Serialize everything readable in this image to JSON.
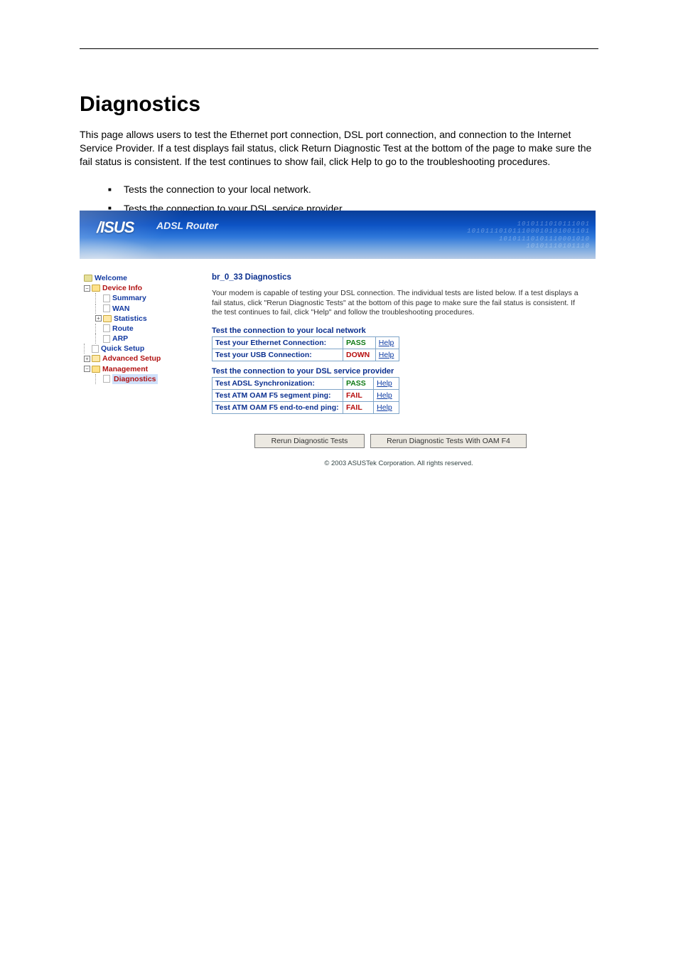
{
  "doc": {
    "section_title": "Diagnostics",
    "intro": "This page allows users to test the Ethernet port connection, DSL port connection, and connection to the Internet Service Provider. If a test displays fail status, click Return Diagnostic Test at the bottom of the page to make sure the fail status is consistent. If the test continues to show fail, click Help to go to the troubleshooting procedures.",
    "bullets": [
      "Tests the connection to your local network.",
      "Tests the connection to your DSL service provider."
    ]
  },
  "banner": {
    "brand": "/ISUS",
    "sub": "ADSL Router",
    "bin1": "1010111010111001",
    "bin2": "101011101011100010101001101",
    "bin3": "10101110101110001010",
    "bin4": "10101110101110"
  },
  "nav": {
    "welcome": "Welcome",
    "device_info": "Device Info",
    "summary": "Summary",
    "wan": "WAN",
    "statistics": "Statistics",
    "route": "Route",
    "arp": "ARP",
    "quick_setup": "Quick Setup",
    "advanced_setup": "Advanced Setup",
    "management": "Management",
    "diagnostics": "Diagnostics"
  },
  "content": {
    "title": "br_0_33 Diagnostics",
    "para": "Your modem is capable of testing your DSL connection. The individual tests are listed below. If a test displays a fail status, click \"Rerun Diagnostic Tests\" at the bottom of this page to make sure the fail status is consistent. If the test continues to fail, click \"Help\" and follow the troubleshooting procedures.",
    "h1": "Test the connection to your local network",
    "h2": "Test the connection to your DSL service provider",
    "local": [
      {
        "name": "Test your Ethernet Connection:",
        "status": "PASS",
        "cls": "pass",
        "help": "Help"
      },
      {
        "name": "Test your USB Connection:",
        "status": "DOWN",
        "cls": "down",
        "help": "Help"
      }
    ],
    "dsl": [
      {
        "name": "Test ADSL Synchronization:",
        "status": "PASS",
        "cls": "pass",
        "help": "Help"
      },
      {
        "name": "Test ATM OAM F5 segment ping:",
        "status": "FAIL",
        "cls": "fail",
        "help": "Help"
      },
      {
        "name": "Test ATM OAM F5 end-to-end ping:",
        "status": "FAIL",
        "cls": "fail",
        "help": "Help"
      }
    ],
    "btn_rerun": "Rerun Diagnostic Tests",
    "btn_rerun_oam": "Rerun Diagnostic Tests With OAM F4",
    "copyright": "© 2003 ASUSTek Corporation. All rights reserved."
  }
}
